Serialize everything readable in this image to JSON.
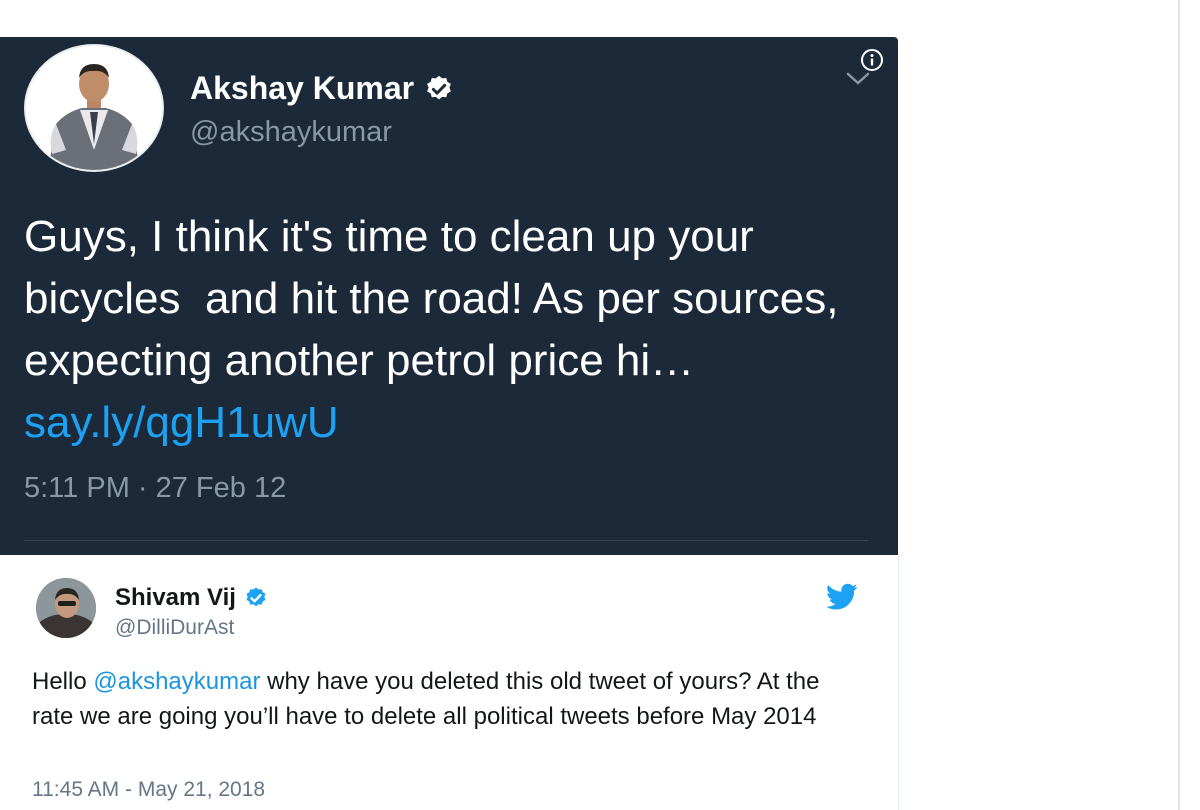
{
  "colors": {
    "dark_card_bg": "#1c2938",
    "link_blue": "#1da1f2",
    "secondary_gray": "#8899a6",
    "twitter_blue": "#1da1f2"
  },
  "original_tweet": {
    "name": "Akshay Kumar",
    "handle": "@akshaykumar",
    "text": "Guys, I think it's time to clean up your bicycles  and hit the road! As per sources, expecting another petrol price hi… ",
    "link": "say.ly/qgH1uwU",
    "timestamp": "5:11 PM · 27 Feb 12",
    "icons": [
      "verified-badge-icon",
      "info-icon",
      "chevron-down-icon"
    ]
  },
  "reply_tweet": {
    "name": "Shivam Vij",
    "handle": "@DilliDurAst",
    "text_before": "Hello ",
    "mention": "@akshaykumar",
    "text_after": " why have you deleted this old tweet of yours? At the rate we are going you’ll have to delete all political tweets before May 2014",
    "timestamp": "11:45 AM - May 21, 2018",
    "icons": [
      "verified-badge-icon",
      "twitter-bird-icon"
    ]
  }
}
